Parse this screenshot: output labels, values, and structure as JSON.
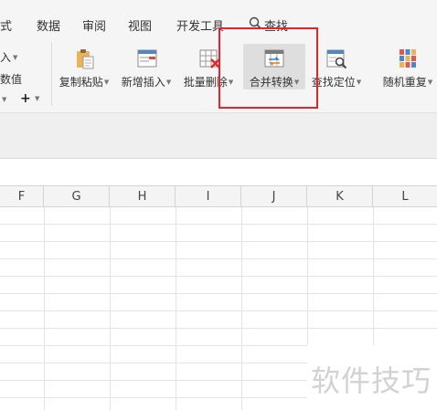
{
  "menubar": {
    "tabs": [
      {
        "label": "式",
        "id": "tab-formula-fragment"
      },
      {
        "label": "数据",
        "id": "tab-data"
      },
      {
        "label": "审阅",
        "id": "tab-review"
      },
      {
        "label": "视图",
        "id": "tab-view"
      },
      {
        "label": "开发工具",
        "id": "tab-developer"
      }
    ],
    "search_label": "查找"
  },
  "ribbon": {
    "left_fragments": {
      "insert": "入",
      "value": "数值"
    },
    "tools": [
      {
        "label": "复制粘贴",
        "icon": "clipboard-paste-icon"
      },
      {
        "label": "新增插入",
        "icon": "insert-table-icon"
      },
      {
        "label": "批量删除",
        "icon": "delete-table-icon"
      },
      {
        "label": "合并转换",
        "icon": "merge-convert-icon"
      },
      {
        "label": "查找定位",
        "icon": "find-locate-icon"
      },
      {
        "label": "随机重复",
        "icon": "random-repeat-icon"
      }
    ],
    "highlight_color": "#e0262c"
  },
  "grid": {
    "columns": [
      "F",
      "G",
      "H",
      "I",
      "J",
      "K",
      "L"
    ]
  },
  "watermark": "软件技巧"
}
